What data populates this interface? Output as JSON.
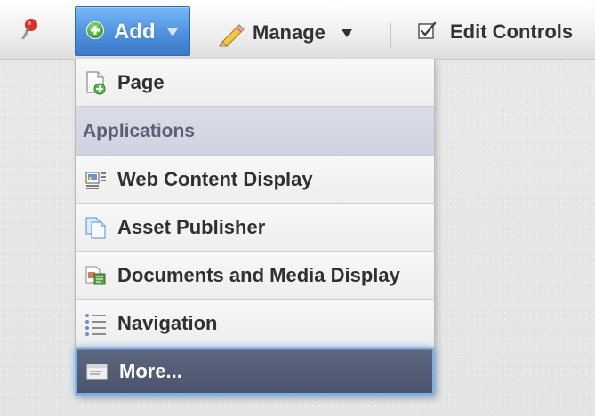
{
  "toolbar": {
    "add_label": "Add",
    "manage_label": "Manage",
    "edit_controls_label": "Edit Controls"
  },
  "add_menu": {
    "items": [
      {
        "label": "Page",
        "icon": "page-add-icon"
      },
      {
        "section_label": "Applications"
      },
      {
        "label": "Web Content Display",
        "icon": "web-content-display-icon"
      },
      {
        "label": "Asset Publisher",
        "icon": "asset-publisher-icon"
      },
      {
        "label": "Documents and Media Display",
        "icon": "documents-and-media-icon"
      },
      {
        "label": "Navigation",
        "icon": "navigation-icon"
      },
      {
        "label": "More...",
        "icon": "more-icon",
        "selected": true
      }
    ]
  },
  "colors": {
    "add_button": "#4e91de",
    "selected_item": "#505a73",
    "section_header": "#d4d8e4",
    "menu_background": "#f4f4f4"
  }
}
